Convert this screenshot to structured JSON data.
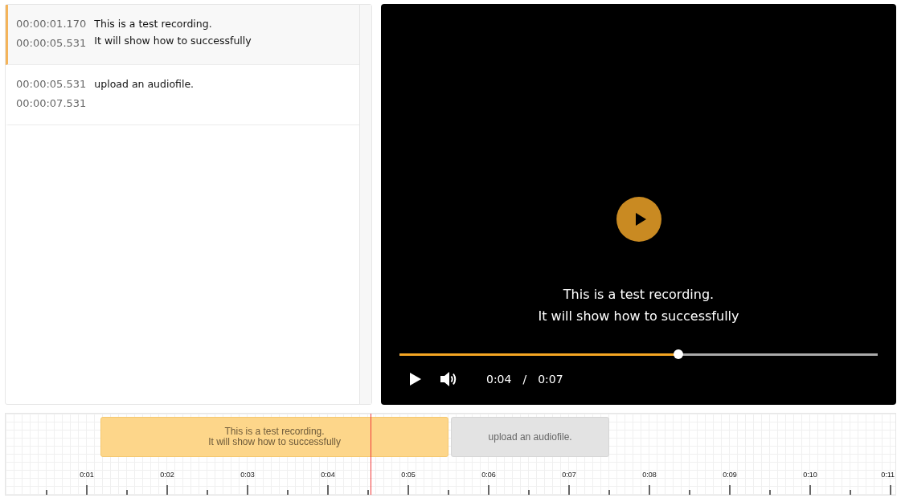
{
  "cues": [
    {
      "start": "00:00:01.170",
      "end": "00:00:05.531",
      "lines": [
        "This is a test recording.",
        "It will show how to successfully"
      ],
      "selected": true
    },
    {
      "start": "00:00:05.531",
      "end": "00:00:07.531",
      "lines": [
        "upload an audiofile."
      ],
      "selected": false
    }
  ],
  "player": {
    "caption_lines": [
      "This is a test recording.",
      "It will show how to successfully"
    ],
    "level": 0.583,
    "current_time": "0:04",
    "separator": "/",
    "duration": "0:07"
  },
  "timeline": {
    "blocks": [
      {
        "lines": [
          "This is a test recording.",
          "It will show how to successfully"
        ],
        "selected": true
      },
      {
        "lines": [
          "upload an audiofile."
        ],
        "selected": false
      }
    ],
    "playhead": {
      "level": 0.41
    },
    "tick_labels": [
      "0:01",
      "0:02",
      "0:03",
      "0:04",
      "0:05",
      "0:06",
      "0:07",
      "0:08",
      "0:09",
      "0:10",
      "0:11"
    ]
  }
}
